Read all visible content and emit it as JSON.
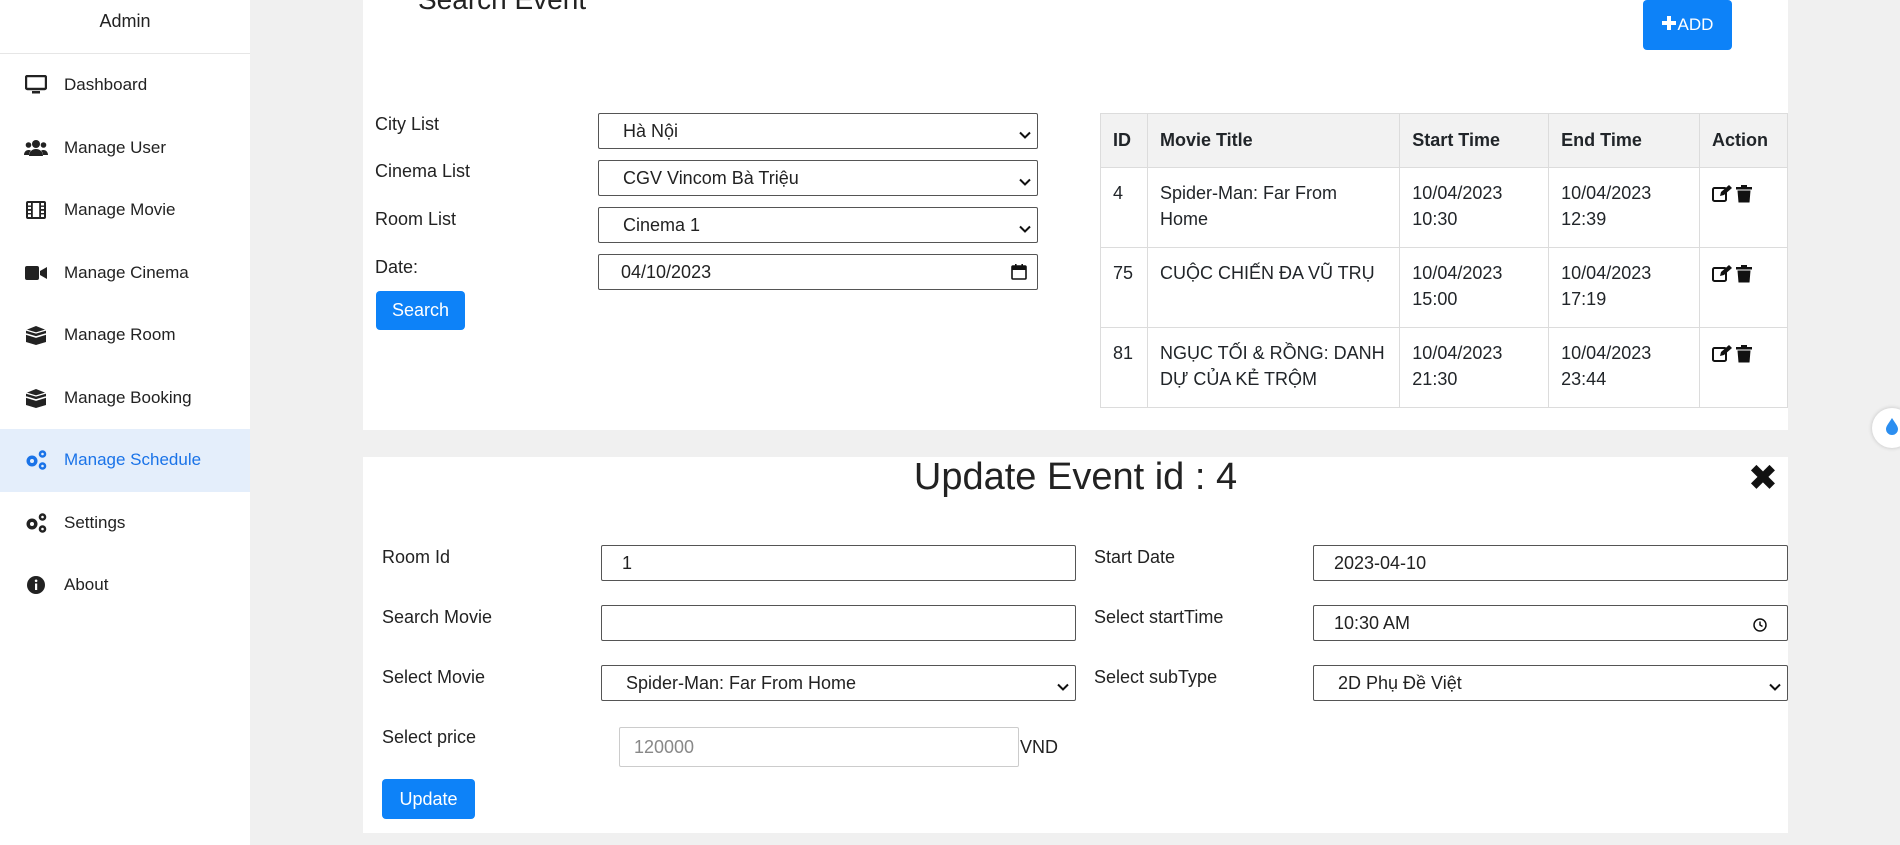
{
  "sidebar": {
    "brand": "Admin",
    "items": [
      {
        "label": "Dashboard",
        "icon": "monitor-icon"
      },
      {
        "label": "Manage User",
        "icon": "users-icon"
      },
      {
        "label": "Manage Movie",
        "icon": "film-icon"
      },
      {
        "label": "Manage Cinema",
        "icon": "video-camera-icon"
      },
      {
        "label": "Manage Room",
        "icon": "room-icon"
      },
      {
        "label": "Manage Booking",
        "icon": "booking-icon"
      },
      {
        "label": "Manage Schedule",
        "icon": "cogs-icon",
        "active": true
      },
      {
        "label": "Settings",
        "icon": "cogs-icon"
      },
      {
        "label": "About",
        "icon": "info-icon"
      }
    ]
  },
  "search": {
    "title": "Search Event",
    "add_label": "ADD",
    "city_label": "City List",
    "city_value": "Hà Nội",
    "cinema_label": "Cinema List",
    "cinema_value": "CGV Vincom Bà Triệu",
    "room_label": "Room List",
    "room_value": "Cinema 1",
    "date_label": "Date:",
    "date_value": "04/10/2023",
    "search_label": "Search"
  },
  "table": {
    "headers": [
      "ID",
      "Movie Title",
      "Start Time",
      "End Time",
      "Action"
    ],
    "rows": [
      {
        "id": "4",
        "title": "Spider-Man: Far From Home",
        "start": "10/04/2023 10:30",
        "end": "10/04/2023 12:39"
      },
      {
        "id": "75",
        "title": "CUỘC CHIẾN ĐA VŨ TRỤ",
        "start": "10/04/2023 15:00",
        "end": "10/04/2023 17:19"
      },
      {
        "id": "81",
        "title": "NGỤC TỐI & RỒNG: DANH DỰ CỦA KẺ TRỘM",
        "start": "10/04/2023 21:30",
        "end": "10/04/2023 23:44"
      }
    ]
  },
  "update": {
    "title": "Update Event id : 4",
    "close": "✖",
    "room_id_label": "Room Id",
    "room_id_value": "1",
    "search_movie_label": "Search Movie",
    "search_movie_value": "",
    "select_movie_label": "Select Movie",
    "select_movie_value": "Spider-Man: Far From Home",
    "price_label": "Select price",
    "price_placeholder": "120000",
    "currency": "VND",
    "start_date_label": "Start Date",
    "start_date_value": "2023-04-10",
    "start_time_label": "Select startTime",
    "start_time_value": "10:30  AM",
    "subtype_label": "Select subType",
    "subtype_value": "2D Phụ Đề Việt",
    "update_label": "Update"
  },
  "colors": {
    "accent": "#0d82f8",
    "active_bg": "#e4eefb",
    "active_text": "#1a73e8"
  }
}
